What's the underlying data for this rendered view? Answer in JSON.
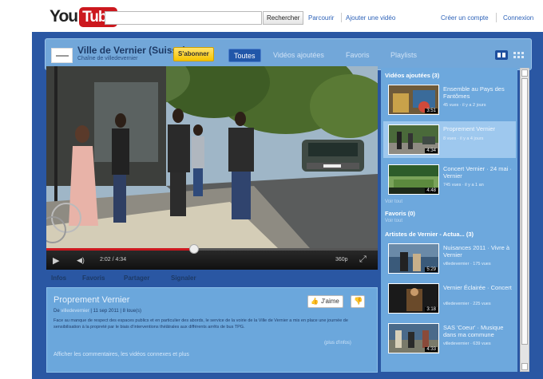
{
  "header": {
    "logo_you": "You",
    "logo_tube": "Tube",
    "search_button": "Rechercher",
    "links": [
      "Parcourir",
      "Ajouter une vidéo"
    ],
    "right_links": [
      "Créer un compte",
      "Connexion"
    ]
  },
  "channel": {
    "title": "Ville de Vernier (Suisse)",
    "subtitle": "Chaîne de villedevernier",
    "subscribe": "S'abonner",
    "tabs": [
      "Toutes",
      "Vidéos ajoutées",
      "Favoris",
      "Playlists"
    ]
  },
  "player": {
    "time": "2:02 / 4:34",
    "quality": "360p",
    "progress_fraction": 0.445
  },
  "info": {
    "tabs": [
      "Infos",
      "Favoris",
      "Partager",
      "Signaler"
    ],
    "title": "Proprement Vernier",
    "meta_prefix": "De",
    "meta_user": "villedevernier",
    "meta_date": "| 11 sep 2011 | 8 loue(s)",
    "description": "Face au manque de respect des espaces publics et en particulier des abords, le service de la voirie de la Ville de Vernier a mis en place une journée de sensibilisation à la propreté par le biais d'interventions théâtrales aux différents arrêts de bus TPG.",
    "more": "(plus d'infos)",
    "comments": "Afficher les commentaires, les vidéos connexes et plus",
    "like": "J'aime"
  },
  "sidebar": {
    "section1": {
      "title": "Vidéos ajoutées (3)",
      "items": [
        {
          "title": "Ensemble au Pays des Fantômes",
          "meta": "45 vues · il y a 2 jours",
          "duration": "3:51"
        },
        {
          "title": "Proprement Vernier",
          "meta": "8 vues · il y a 4 jours",
          "duration": "4:34"
        },
        {
          "title": "Concert Vernier · 24 mai · Vernier",
          "meta": "745 vues · il y a 1 an",
          "duration": "4:48"
        }
      ],
      "more": "Voir tout"
    },
    "section2": {
      "title": "Favoris (0)",
      "sub": "Voir tout"
    },
    "section3": {
      "title": "Artistes de Vernier - Actua... (3)",
      "items": [
        {
          "title": "Nuisances 2011 · Vivre à Vernier",
          "user": "villedevernier",
          "meta": "· 175 vues",
          "duration": "5:29"
        },
        {
          "title": "Vernier Éclairée · Concert",
          "user": "villedevernier",
          "meta": "· 225 vues",
          "duration": "3:18"
        },
        {
          "title": "SAS 'Coeur' · Musique dans ma commune",
          "user": "villedevernier",
          "meta": "· 639 vues",
          "duration": "4:33"
        }
      ]
    }
  },
  "colors": {
    "frame": "#2a57a3",
    "panel": "#6ba7dc",
    "accent": "#cc181e",
    "subscribe": "#f5c400"
  }
}
